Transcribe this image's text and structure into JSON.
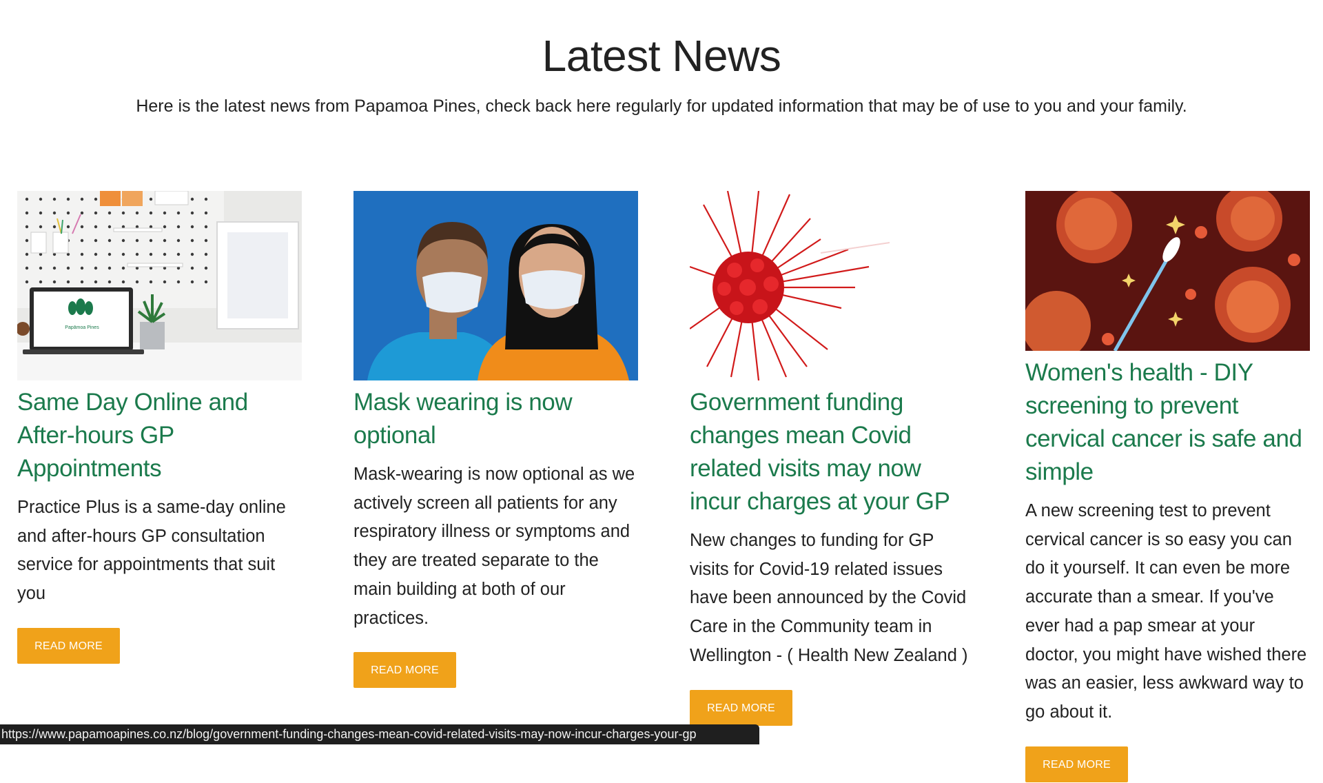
{
  "header": {
    "title": "Latest News",
    "intro": "Here is the latest news from Papamoa Pines, check back here regularly for updated information that may be of use to you and your family."
  },
  "articles": [
    {
      "title": "Same Day Online and After-hours GP Appointments",
      "excerpt": "Practice Plus is a same-day online and after-hours GP consultation service for appointments that suit you",
      "button_label": "READ MORE",
      "image_desc": "desk-with-laptop-image",
      "laptop_logo_text": "Papāmoa Pines"
    },
    {
      "title": "Mask wearing is now optional",
      "excerpt": "Mask-wearing is now optional as we actively screen all patients for any respiratory illness or symptoms and they are treated separate to the main building at both of our practices.",
      "button_label": "READ MORE",
      "image_desc": "people-wearing-masks-image"
    },
    {
      "title": "Government funding changes mean Covid related visits may now incur charges at your GP",
      "excerpt": "New changes to funding for GP visits for Covid-19 related issues have been announced by the Covid Care in the Community team in Wellington - ( Health New Zealand )",
      "button_label": "READ MORE",
      "image_desc": "virus-image"
    },
    {
      "title": "Women's health - DIY screening to prevent cervical cancer is safe and simple",
      "excerpt": "A new screening test to prevent cervical cancer is so easy you can do it yourself. It can even be more accurate than a smear. If you've ever had a pap smear at your doctor, you might have wished there was an easier, less awkward way to go about it.",
      "button_label": "READ MORE",
      "image_desc": "swab-and-cells-image"
    }
  ],
  "status_bar": {
    "url": "https://www.papamoapines.co.nz/blog/government-funding-changes-mean-covid-related-visits-may-now-incur-charges-your-gp"
  },
  "colors": {
    "accent_green": "#1b7a4c",
    "button_orange": "#f0a21a",
    "text_dark": "#222222"
  }
}
